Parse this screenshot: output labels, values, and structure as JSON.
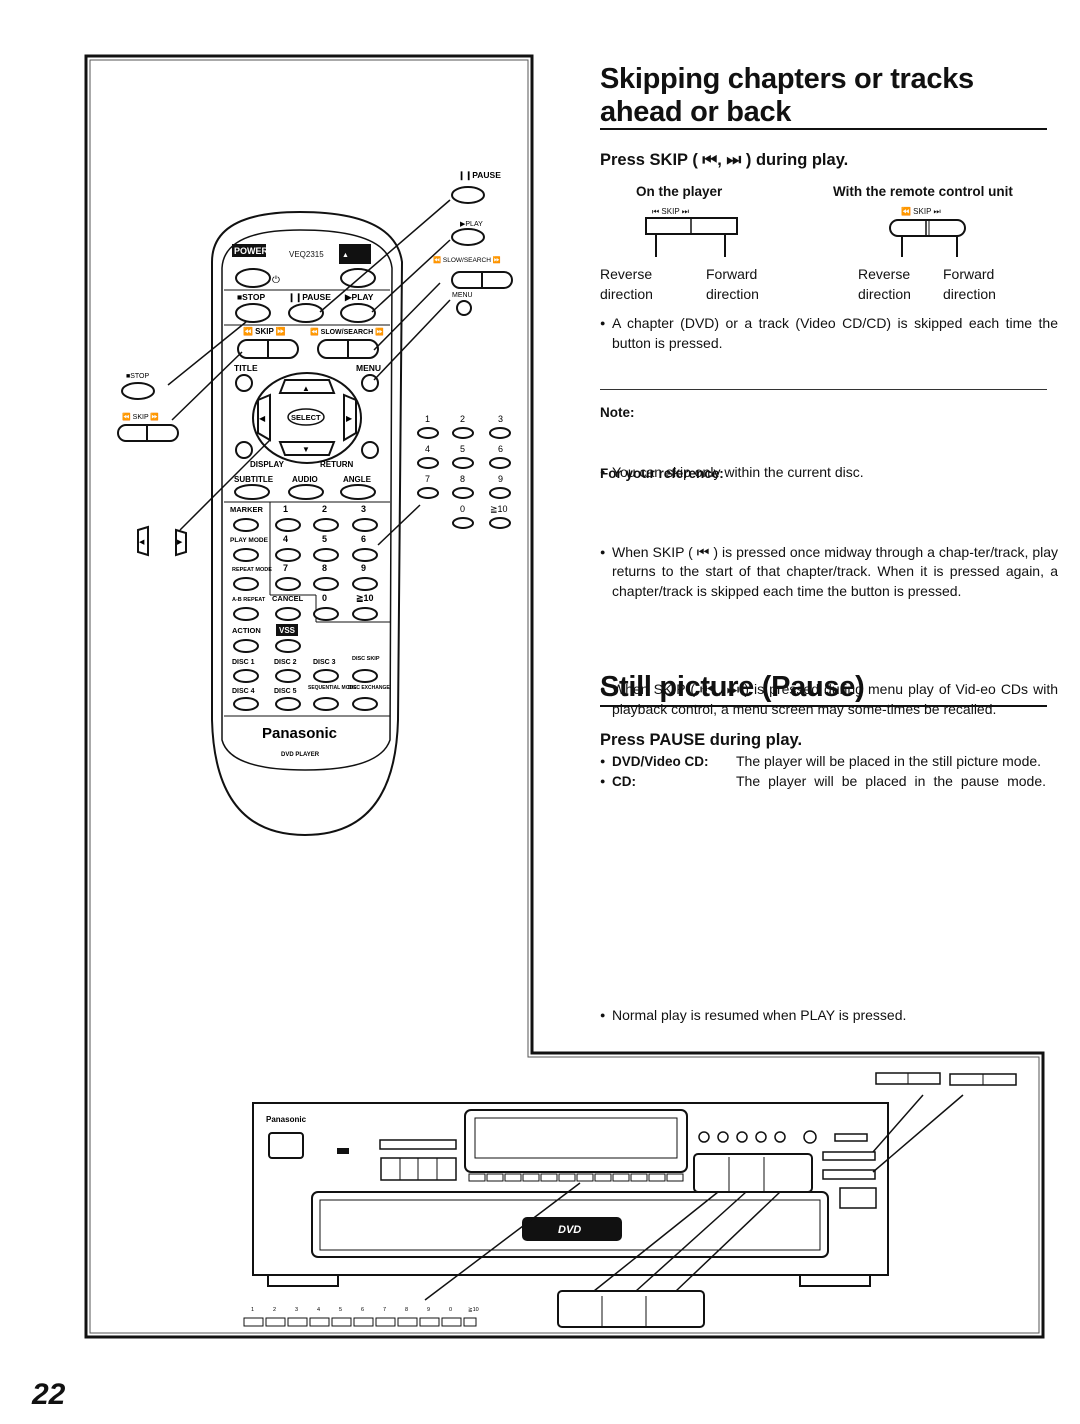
{
  "page": {
    "number": "22"
  },
  "skip_section": {
    "title_line1": "Skipping chapters or tracks",
    "title_line2": "ahead or back",
    "instruction": "Press SKIP ( ⏮, ⏭ ) during play.",
    "on_player": {
      "heading": "On the player",
      "button_label": "⏮  SKIP  ⏭",
      "reverse": [
        "Reverse",
        "direction"
      ],
      "forward": [
        "Forward",
        "direction"
      ]
    },
    "on_remote": {
      "heading": "With the remote control unit",
      "button_label": "⏪ SKIP ⏭",
      "reverse": [
        "Reverse",
        "direction"
      ],
      "forward": [
        "Forward",
        "direction"
      ]
    },
    "bullet": "A chapter (DVD) or a track (Video CD/CD) is skipped each time the button is pressed.",
    "note_heading": "Note:",
    "note_bullet": "You can skip only within the current disc.",
    "reference_heading": "For your reference:",
    "reference_bullets": [
      "When  SKIP ( ⏮ ) is pressed once midway through a chap-ter/track, play returns to the start of that chapter/track. When it is pressed again, a chapter/track is skipped each time the button is pressed.",
      "When SKIP ( ⏮ , ⏭ ) is pressed during menu play of Vid-eo CDs with playback control, a menu screen may some-times be recalled."
    ]
  },
  "pause_section": {
    "title": "Still picture (Pause)",
    "instruction": "Press PAUSE during play.",
    "items": [
      {
        "label": "DVD/Video CD:",
        "text": "The player will be placed in the still picture mode."
      },
      {
        "label": "CD:",
        "text": "The player will be placed in the pause mode."
      }
    ],
    "bullet": "Normal play is resumed when PLAY is pressed."
  },
  "remote": {
    "model": "VEQ2315",
    "power": "POWER",
    "open_close": "OPEN/ CLOSE",
    "stop": "■STOP",
    "pause": "❙❙PAUSE",
    "play": "▶PLAY",
    "skip": "⏪ SKIP ⏩",
    "slow_search": "⏪ SLOW/SEARCH ⏩",
    "title": "TITLE",
    "menu": "MENU",
    "select": "SELECT",
    "display": "DISPLAY",
    "return": "RETURN",
    "subtitle": "SUBTITLE",
    "audio": "AUDIO",
    "angle": "ANGLE",
    "marker": "MARKER",
    "play_mode": "PLAY MODE",
    "repeat_mode": "REPEAT MODE",
    "ab_repeat": "A-B REPEAT",
    "cancel": "CANCEL",
    "action": "ACTION",
    "vss": "VSS",
    "numbers": [
      "1",
      "2",
      "3",
      "4",
      "5",
      "6",
      "7",
      "8",
      "9",
      "0",
      "≧10"
    ],
    "discs": [
      "DISC 1",
      "DISC 2",
      "DISC 3",
      "DISC SKIP",
      "DISC 4",
      "DISC 5",
      "SEQUENTIAL MODE",
      "DISC EXCHANGE"
    ],
    "brand": "Panasonic",
    "subtitle_brand": "DVD PLAYER"
  },
  "callouts": {
    "pause": "❙❙PAUSE",
    "play": "▶PLAY",
    "slow_search": "⏪ SLOW/SEARCH ⏩",
    "menu": "MENU",
    "stop": "■STOP",
    "skip": "⏪ SKIP ⏩",
    "numbers": [
      "1",
      "2",
      "3",
      "4",
      "5",
      "6",
      "7",
      "8",
      "9",
      "0",
      "≧10"
    ]
  },
  "player_unit": {
    "brand": "Panasonic",
    "logo": "DVD",
    "bottom_numbers": [
      "1",
      "2",
      "3",
      "4",
      "5",
      "6",
      "7",
      "8",
      "9",
      "0",
      "≧10"
    ]
  }
}
